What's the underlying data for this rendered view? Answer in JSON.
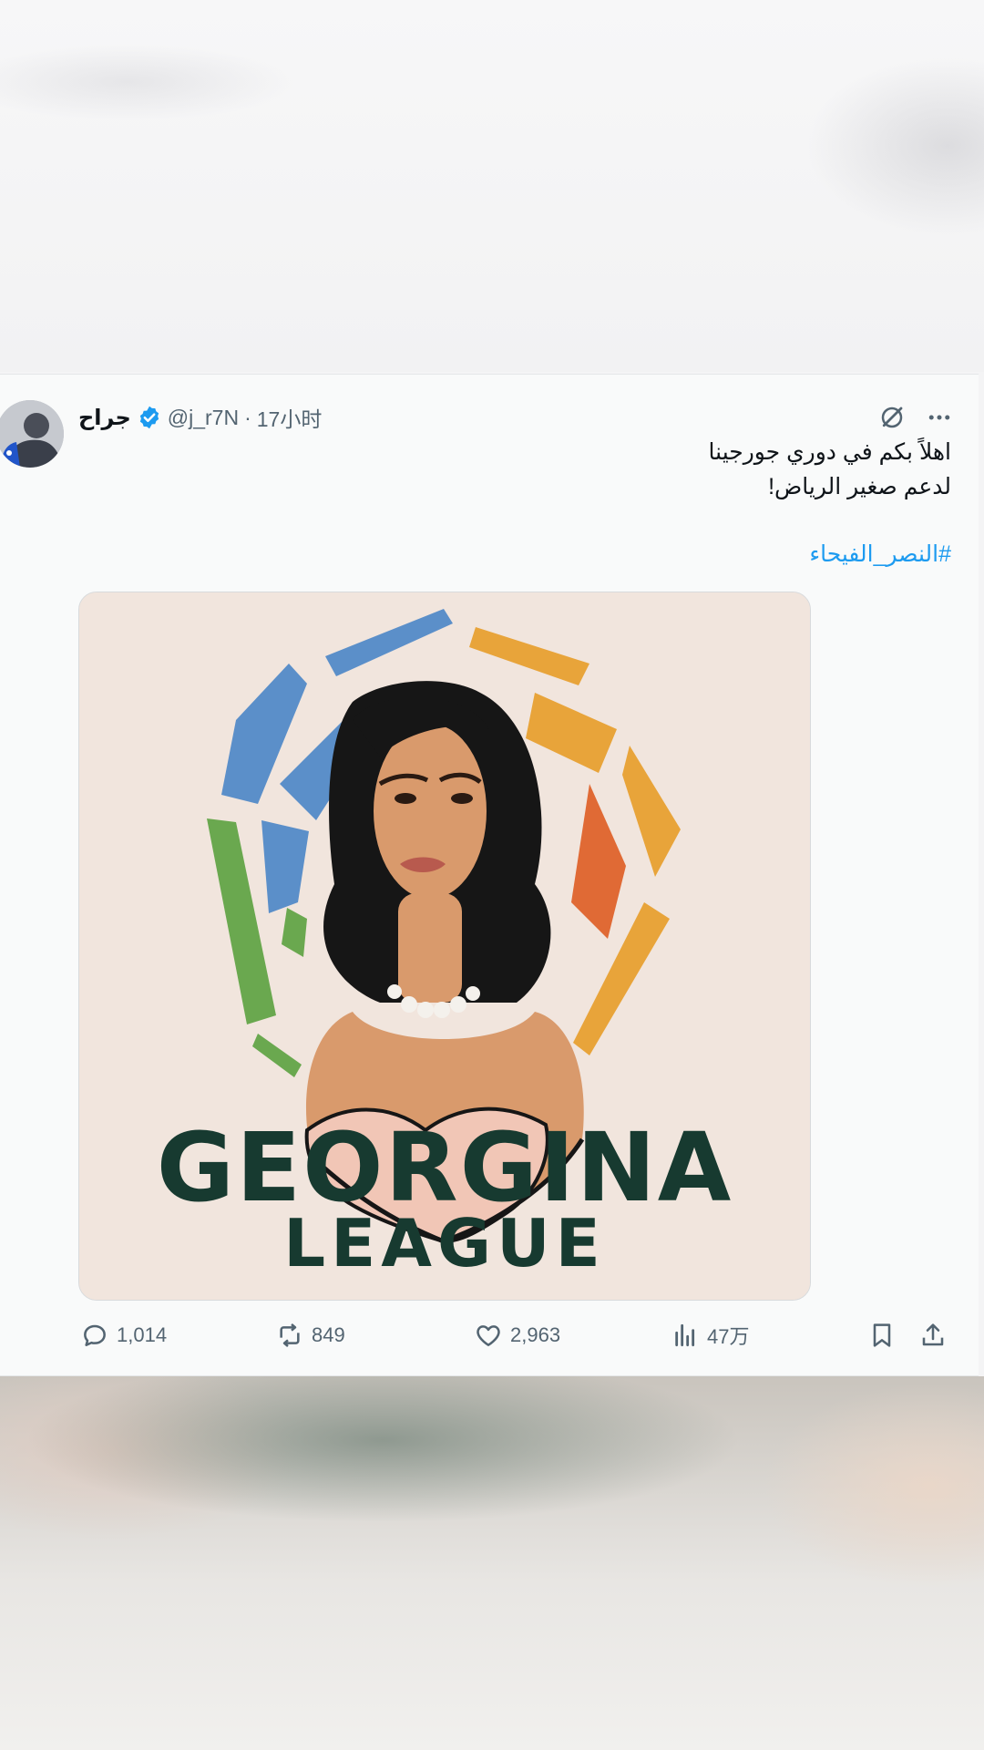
{
  "tweet": {
    "author_name": "جراح",
    "handle": "@j_r7N",
    "separator": "·",
    "time": "17小时",
    "text_line1": "اهلاً بكم في دوري جورجينا",
    "text_line2": "لدعم صغير الرياض!",
    "hashtag": "#النصر_الفيحاء",
    "image": {
      "logo_line1": "GEORGINA",
      "logo_line2": "LEAGUE"
    },
    "actions": {
      "replies": "1,014",
      "reposts": "849",
      "likes": "2,963",
      "views": "47万"
    }
  },
  "icons": [
    "grok-icon",
    "more-icon",
    "verified-icon",
    "reply-icon",
    "repost-icon",
    "like-icon",
    "views-icon",
    "bookmark-icon",
    "share-icon"
  ],
  "colors": {
    "accent": "#1d9bf0",
    "verified": "#1d9bf0",
    "text": "#0f1419",
    "muted": "#536471"
  }
}
